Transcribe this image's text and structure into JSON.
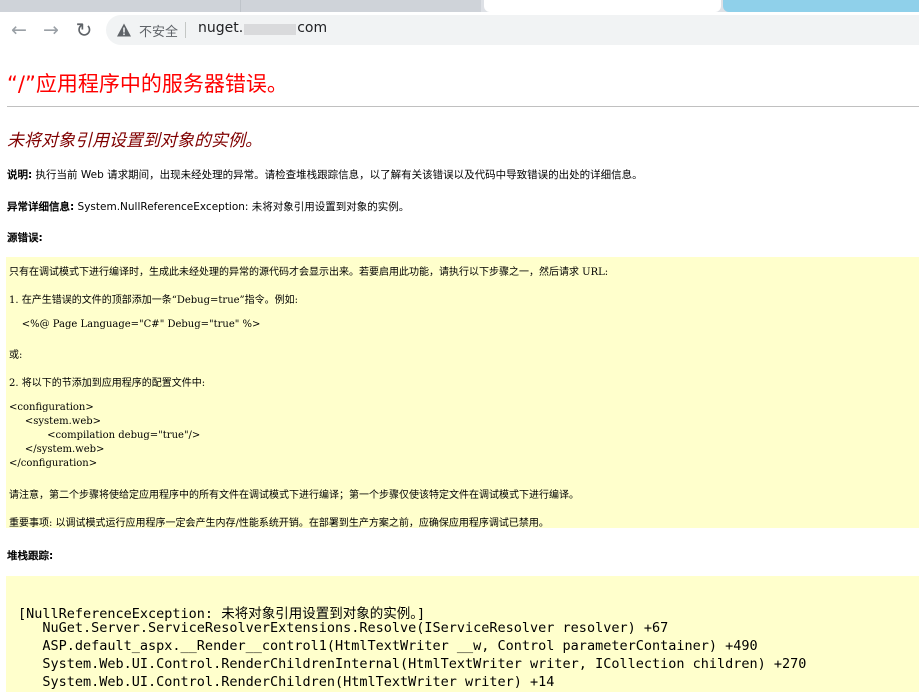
{
  "browser": {
    "insecure_label": "不安全",
    "url_prefix": "nuget.",
    "url_suffix": "com",
    "icons": {
      "back": "arrow-left-icon",
      "forward": "arrow-right-icon",
      "reload": "reload-icon",
      "security": "warning-triangle-icon"
    }
  },
  "error": {
    "title": "“/”应用程序中的服务器错误。",
    "subtitle": "未将对象引用设置到对象的实例。",
    "description_label": "说明:",
    "description_text": " 执行当前 Web 请求期间，出现未经处理的异常。请检查堆栈跟踪信息，以了解有关该错误以及代码中导致错误的出处的详细信息。",
    "exception_label": "异常详细信息:",
    "exception_text": " System.NullReferenceException: 未将对象引用设置到对象的实例。",
    "source_error_label": "源错误:",
    "stack_trace_label": "堆栈跟踪:"
  },
  "source_box": {
    "lines": [
      "只有在调试模式下进行编译时，生成此未经处理的异常的源代码才会显示出来。若要启用此功能，请执行以下步骤之一，然后请求 URL:",
      "1. 在产生错误的文件的顶部添加一条“Debug=true”指令。例如:",
      "    <%@ Page Language=\"C#\" Debug=\"true\" %>",
      "或:",
      "2. 将以下的节添加到应用程序的配置文件中:",
      "<configuration>",
      "     <system.web>",
      "            <compilation debug=\"true\"/>",
      "     </system.web>",
      "</configuration>",
      "请注意，第二个步骤将使给定应用程序中的所有文件在调试模式下进行编译；第一个步骤仅使该特定文件在调试模式下进行编译。",
      "重要事项: 以调试模式运行应用程序一定会产生内存/性能系统开销。在部署到生产方案之前，应确保应用程序调试已禁用。"
    ]
  },
  "stack_box": {
    "lines": [
      "[NullReferenceException: 未将对象引用设置到对象的实例。]",
      "   NuGet.Server.ServiceResolverExtensions.Resolve(IServiceResolver resolver) +67",
      "   ASP.default_aspx.__Render__control1(HtmlTextWriter __w, Control parameterContainer) +490",
      "   System.Web.UI.Control.RenderChildrenInternal(HtmlTextWriter writer, ICollection children) +270",
      "   System.Web.UI.Control.RenderChildren(HtmlTextWriter writer) +14"
    ]
  }
}
